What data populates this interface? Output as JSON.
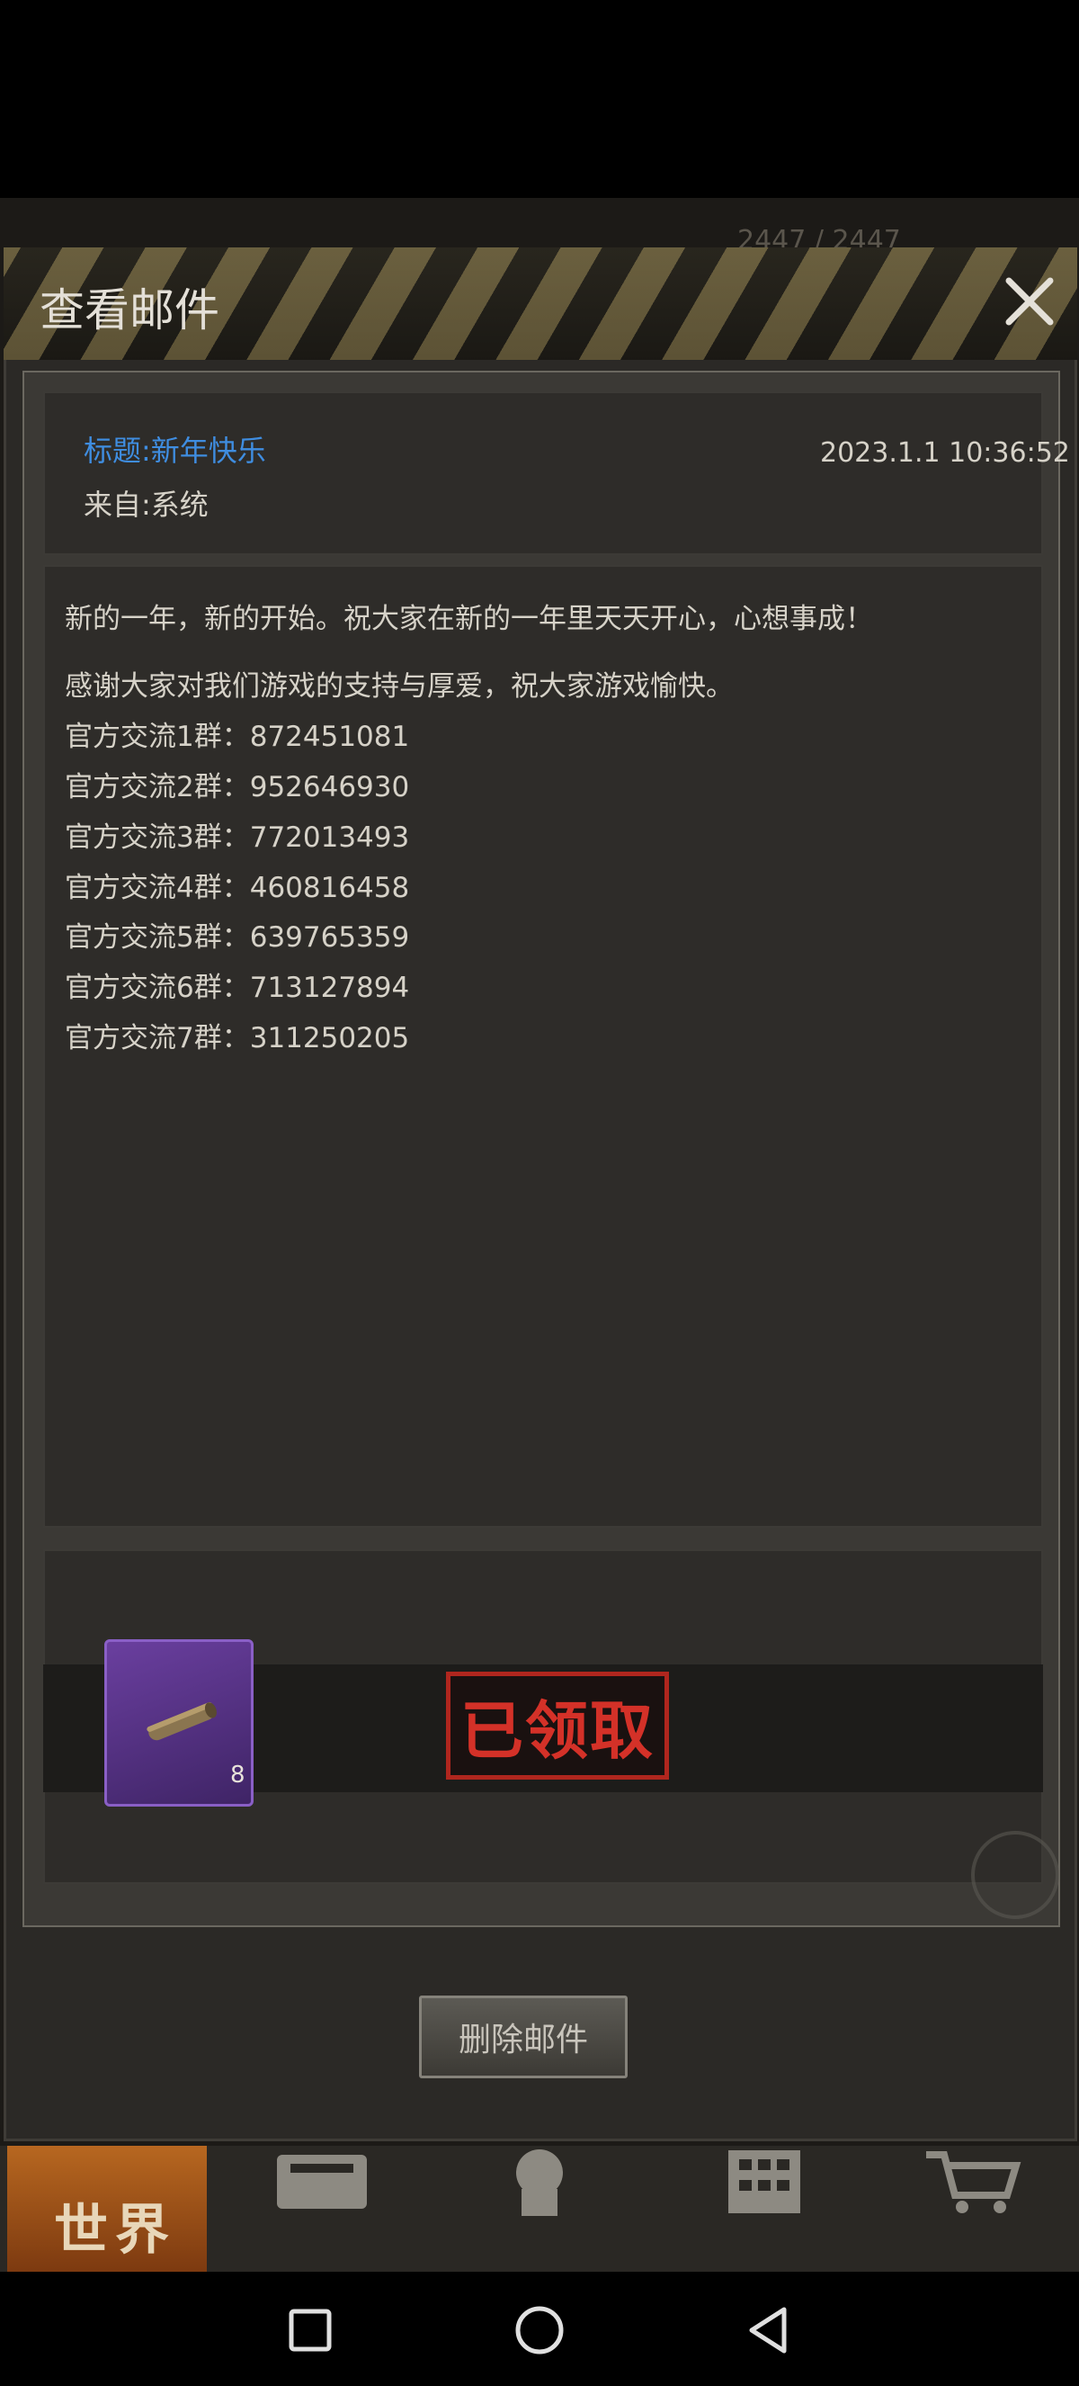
{
  "background": {
    "top_stat": "2447 / 2447",
    "nav": {
      "world_label": "世界"
    }
  },
  "dialog": {
    "title": "查看邮件",
    "close_icon": "close-icon"
  },
  "mail": {
    "subject": "标题:新年快乐",
    "sender": "来自:系统",
    "date": "2023.1.1 10:36:52",
    "body": [
      "新的一年，新的开始。祝大家在新的一年里天天开心，心想事成！",
      "感谢大家对我们游戏的支持与厚爱，祝大家游戏愉快。",
      "官方交流1群：872451081",
      "官方交流2群：952646930",
      "官方交流3群：772013493",
      "官方交流4群：460816458",
      "官方交流5群：639765359",
      "官方交流6群：713127894",
      "官方交流7群：311250205"
    ]
  },
  "attachment": {
    "item_icon": "log-icon",
    "count": "8",
    "status": "已领取"
  },
  "actions": {
    "delete_label": "删除邮件"
  },
  "colors": {
    "subject": "#3f8de0",
    "stamp": "#d43128",
    "slot": "#6a3f9f"
  }
}
